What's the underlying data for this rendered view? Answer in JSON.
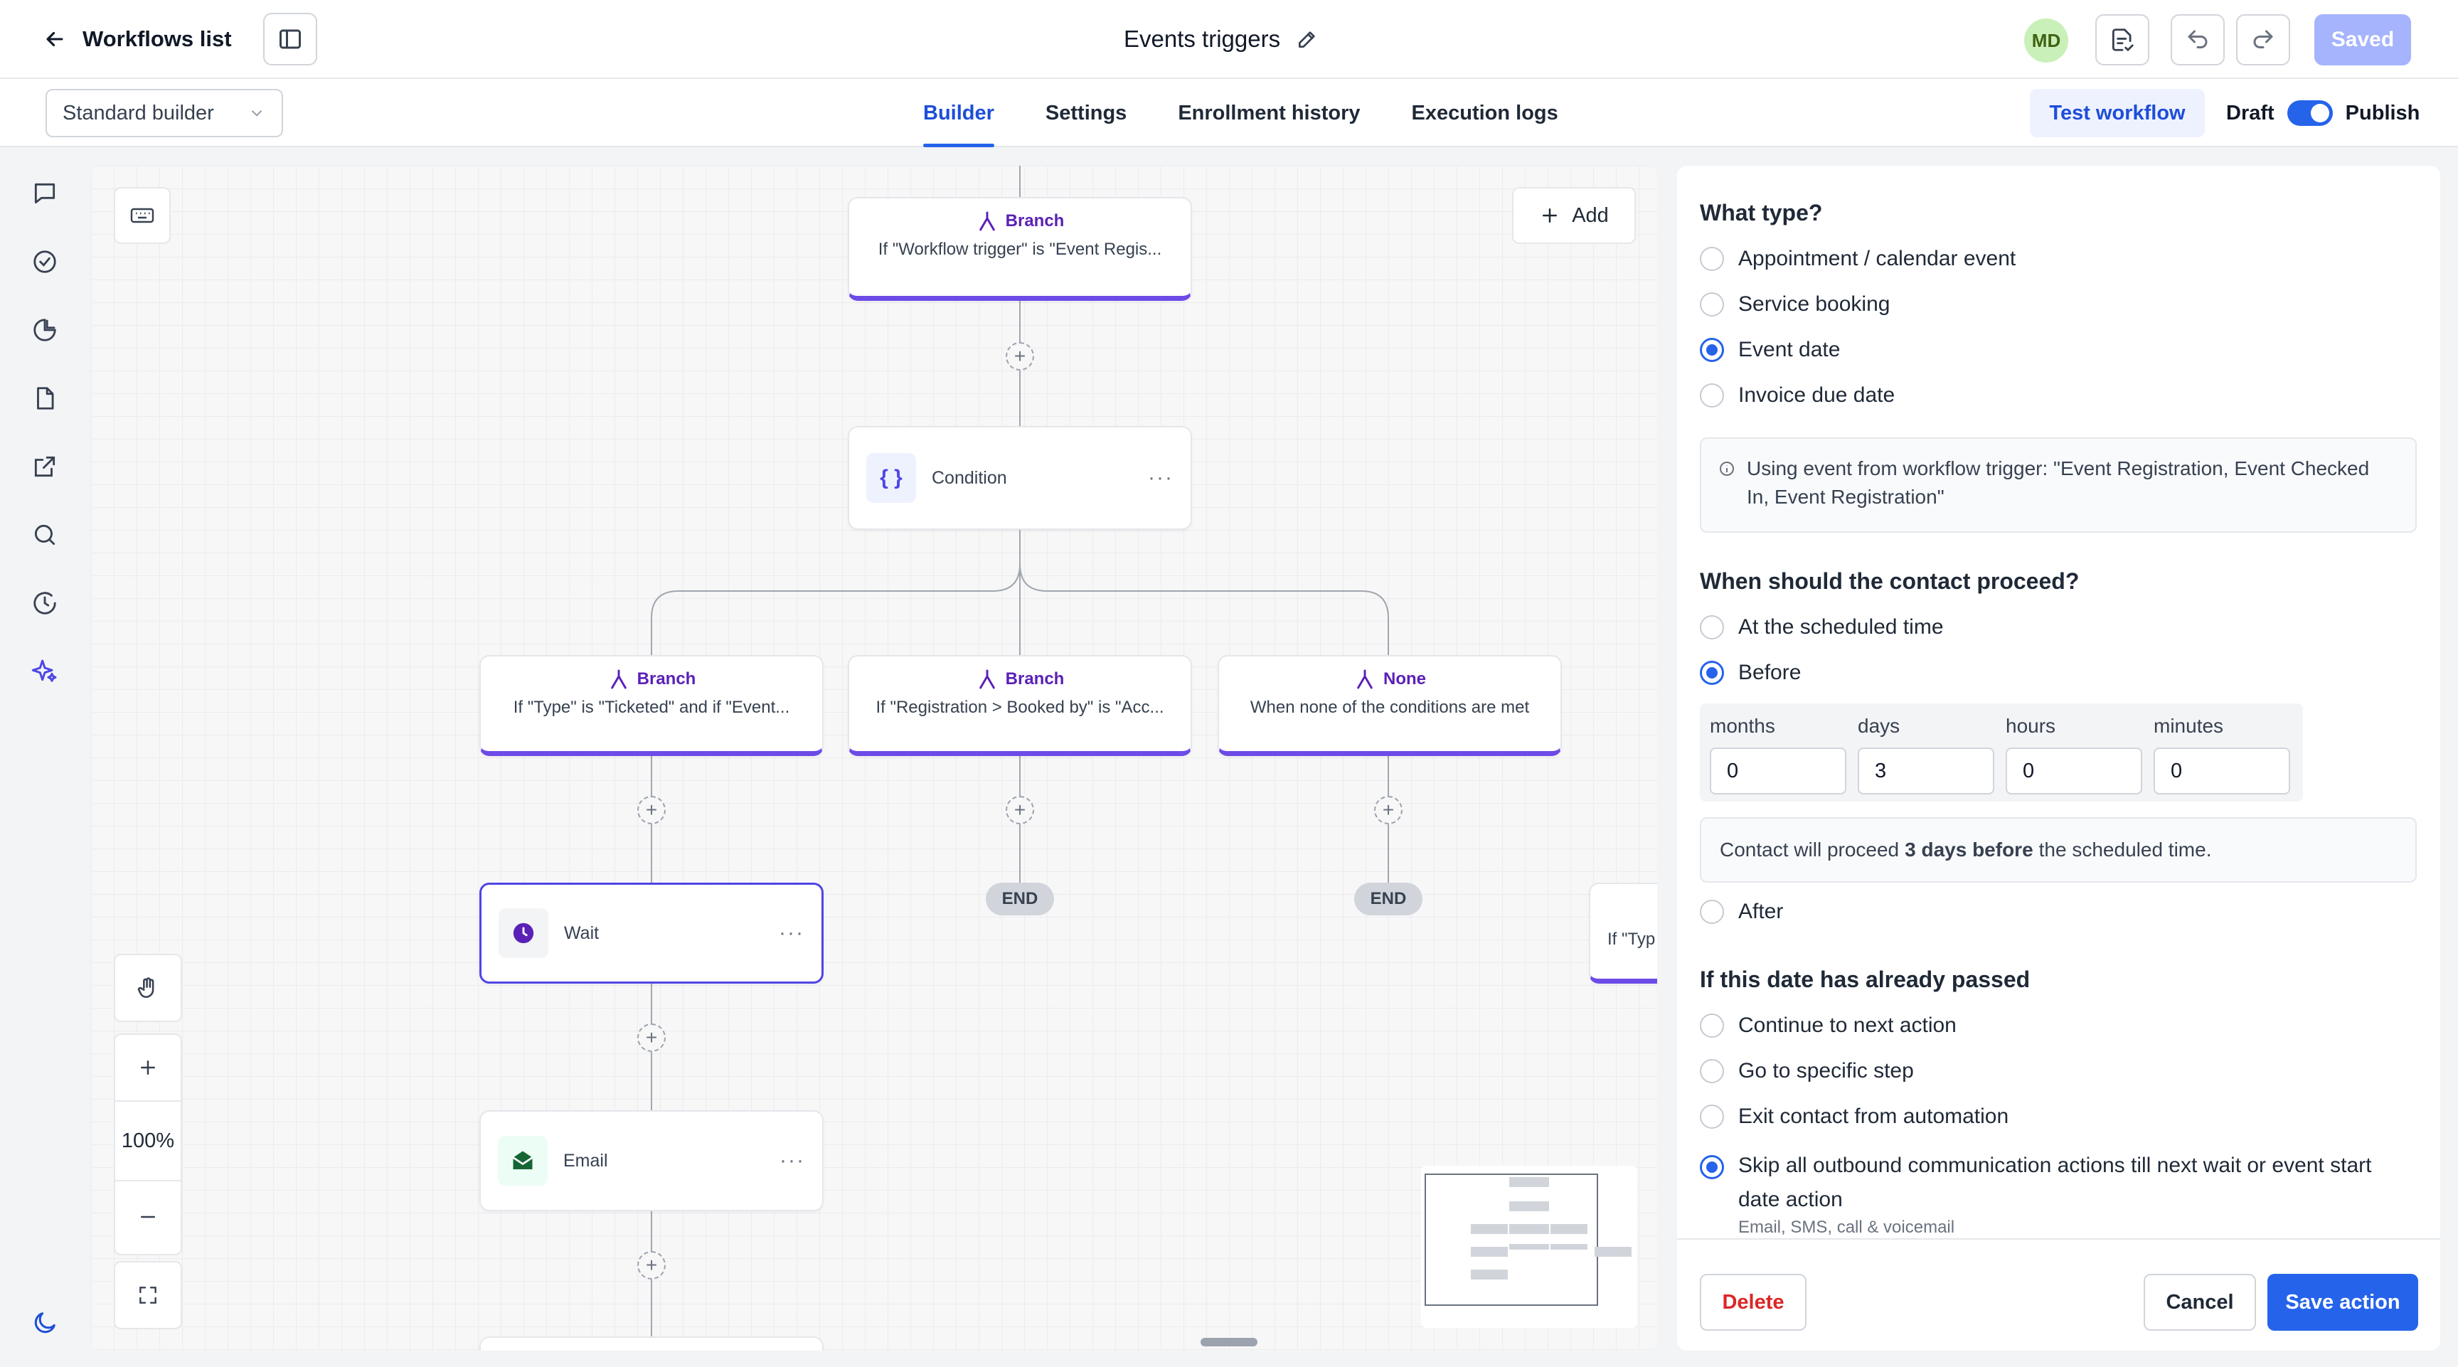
{
  "header": {
    "back_label": "Workflows list",
    "title": "Events triggers",
    "avatar_initials": "MD",
    "saved_label": "Saved"
  },
  "subbar": {
    "builder_select": "Standard builder",
    "tabs": [
      {
        "label": "Builder",
        "active": true
      },
      {
        "label": "Settings",
        "active": false
      },
      {
        "label": "Enrollment history",
        "active": false
      },
      {
        "label": "Execution logs",
        "active": false
      }
    ],
    "test_label": "Test workflow",
    "draft_label": "Draft",
    "publish_label": "Publish",
    "publish_on": true
  },
  "canvas": {
    "add_label": "Add",
    "zoom": "100%",
    "top_branch": {
      "head": "Branch",
      "text": "If \"Workflow trigger\" is \"Event Regis..."
    },
    "condition_label": "Condition",
    "branches": [
      {
        "head": "Branch",
        "text": "If \"Type\" is \"Ticketed\" and if \"Event..."
      },
      {
        "head": "Branch",
        "text": "If \"Registration > Booked by\" is \"Acc..."
      },
      {
        "head": "None",
        "text": "When none of the conditions are met"
      }
    ],
    "wait_label": "Wait",
    "email_label": "Email",
    "end_label": "END",
    "partial_text": "If \"Typ"
  },
  "panel": {
    "type_title": "What type?",
    "type_options": [
      {
        "label": "Appointment / calendar event",
        "checked": false
      },
      {
        "label": "Service booking",
        "checked": false
      },
      {
        "label": "Event date",
        "checked": true
      },
      {
        "label": "Invoice due date",
        "checked": false
      }
    ],
    "info_text": "Using event from workflow trigger: \"Event Registration, Event Checked In, Event Registration\"",
    "proceed_title": "When should the contact proceed?",
    "scheduled_label": "At the scheduled time",
    "before_label": "Before",
    "duration": [
      {
        "label": "months",
        "value": "0"
      },
      {
        "label": "days",
        "value": "3"
      },
      {
        "label": "hours",
        "value": "0"
      },
      {
        "label": "minutes",
        "value": "0"
      }
    ],
    "summary_prefix": "Contact will proceed",
    "summary_bold": "3 days before",
    "summary_suffix": "the scheduled time.",
    "after_label": "After",
    "passed_title": "If this date has already passed",
    "passed_options": [
      {
        "label": "Continue to next action",
        "checked": false
      },
      {
        "label": "Go to specific step",
        "checked": false
      },
      {
        "label": "Exit contact from automation",
        "checked": false
      },
      {
        "label": "Skip all outbound communication actions till next wait or event start date action",
        "checked": true
      }
    ],
    "skip_note": "Email, SMS, call & voicemail",
    "delete_label": "Delete",
    "cancel_label": "Cancel",
    "save_label": "Save action"
  },
  "colors": {
    "accent": "#2563eb",
    "branch": "#6d4be6",
    "delete": "#dc2626"
  }
}
